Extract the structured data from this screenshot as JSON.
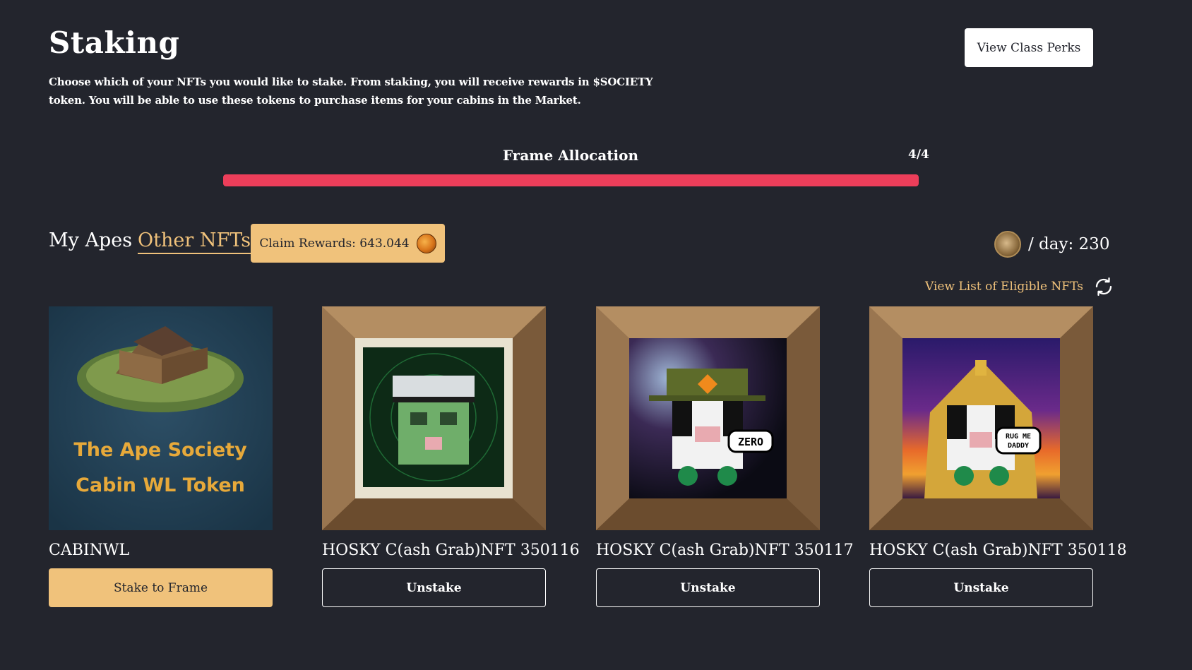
{
  "header": {
    "title": "Staking",
    "description": "Choose which of your NFTs you would like to stake. From staking, you will receive rewards in $SOCIETY token. You will be able to use these tokens to purchase items for your cabins in the Market.",
    "perks_button": "View Class Perks"
  },
  "allocation": {
    "label": "Frame Allocation",
    "count": "4/4",
    "fill_fraction": 1.0,
    "bar_color": "#ec3e5a"
  },
  "tabs": [
    {
      "label": "My Apes",
      "active": false
    },
    {
      "label": "Other NFTs",
      "active": true
    }
  ],
  "claim": {
    "label": "Claim Rewards: 643.044",
    "icon": "society-coin-icon"
  },
  "rate": {
    "label": "/ day: 230",
    "icon": "society-medallion-icon"
  },
  "eligible": {
    "label": "View List of Eligible NFTs",
    "icon": "refresh-icon"
  },
  "nfts": [
    {
      "name": "CABINWL",
      "image_text_1": "The Ape Society",
      "image_text_2": "Cabin WL Token",
      "button": "Stake to Frame",
      "button_style": "stake"
    },
    {
      "name": "HOSKY C(ash Grab)NFT 350116",
      "button": "Unstake",
      "button_style": "unstake"
    },
    {
      "name": "HOSKY C(ash Grab)NFT 350117",
      "speech": "ZERO",
      "button": "Unstake",
      "button_style": "unstake"
    },
    {
      "name": "HOSKY C(ash Grab)NFT 350118",
      "speech_1": "RUG ME",
      "speech_2": "DADDY",
      "button": "Unstake",
      "button_style": "unstake"
    }
  ],
  "colors": {
    "background": "#23252d",
    "accent": "#f0c27b",
    "progress": "#ec3e5a"
  }
}
